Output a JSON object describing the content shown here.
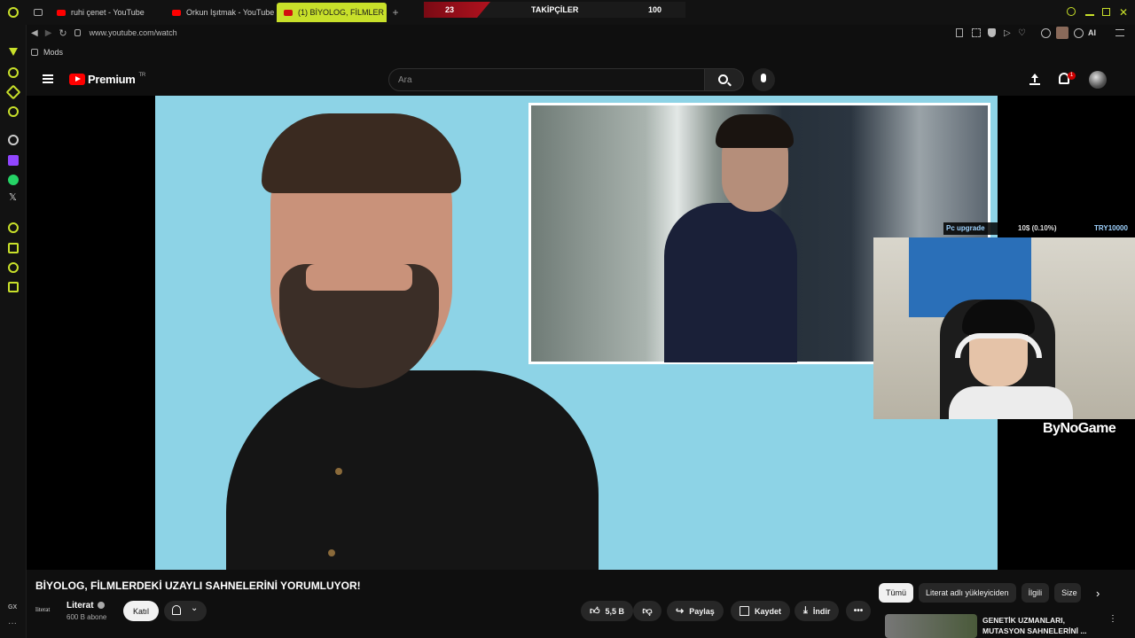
{
  "browser": {
    "tabs": [
      {
        "label": "ruhi çenet - YouTube"
      },
      {
        "label": "Orkun Işıtmak - YouTube"
      },
      {
        "label": "(1) BİYOLOG, FİLMLER"
      }
    ],
    "new_tab": "+",
    "url": "www.youtube.com/watch",
    "bookmark": "Mods",
    "ai_label": "AI"
  },
  "stream_overlay": {
    "left_count": "23",
    "label": "TAKİPÇİLER",
    "right_count": "100",
    "ticker_goal": "Pc upgrade",
    "ticker_progress": "10$ (0.10%)",
    "ticker_target": "TRY10000",
    "watermark": "ByNoGame"
  },
  "youtube": {
    "brand": "Premium",
    "region": "TR",
    "search_placeholder": "Ara",
    "notif_count": "1"
  },
  "video": {
    "title": "BİYOLOG, FİLMLERDEKİ UZAYLI SAHNELERİNİ YORUMLUYOR!",
    "channel_logo": "literat",
    "channel_name": "Literat",
    "subscribers": "600 B abone",
    "join_label": "Katıl",
    "likes": "5,5 B",
    "share_label": "Paylaş",
    "save_label": "Kaydet",
    "download_label": "İndir"
  },
  "chips": [
    "Tümü",
    "Literat adlı yükleyiciden",
    "İlgili",
    "Size"
  ],
  "recommendation": {
    "title_line1": "GENETİK UZMANLARI,",
    "title_line2": "MUTASYON SAHNELERİNİ ..."
  },
  "sidebar_bottom": "GX",
  "colors": {
    "accent": "#c8e02a",
    "youtube_red": "#ff0000",
    "video_bg": "#8dd3e6"
  }
}
